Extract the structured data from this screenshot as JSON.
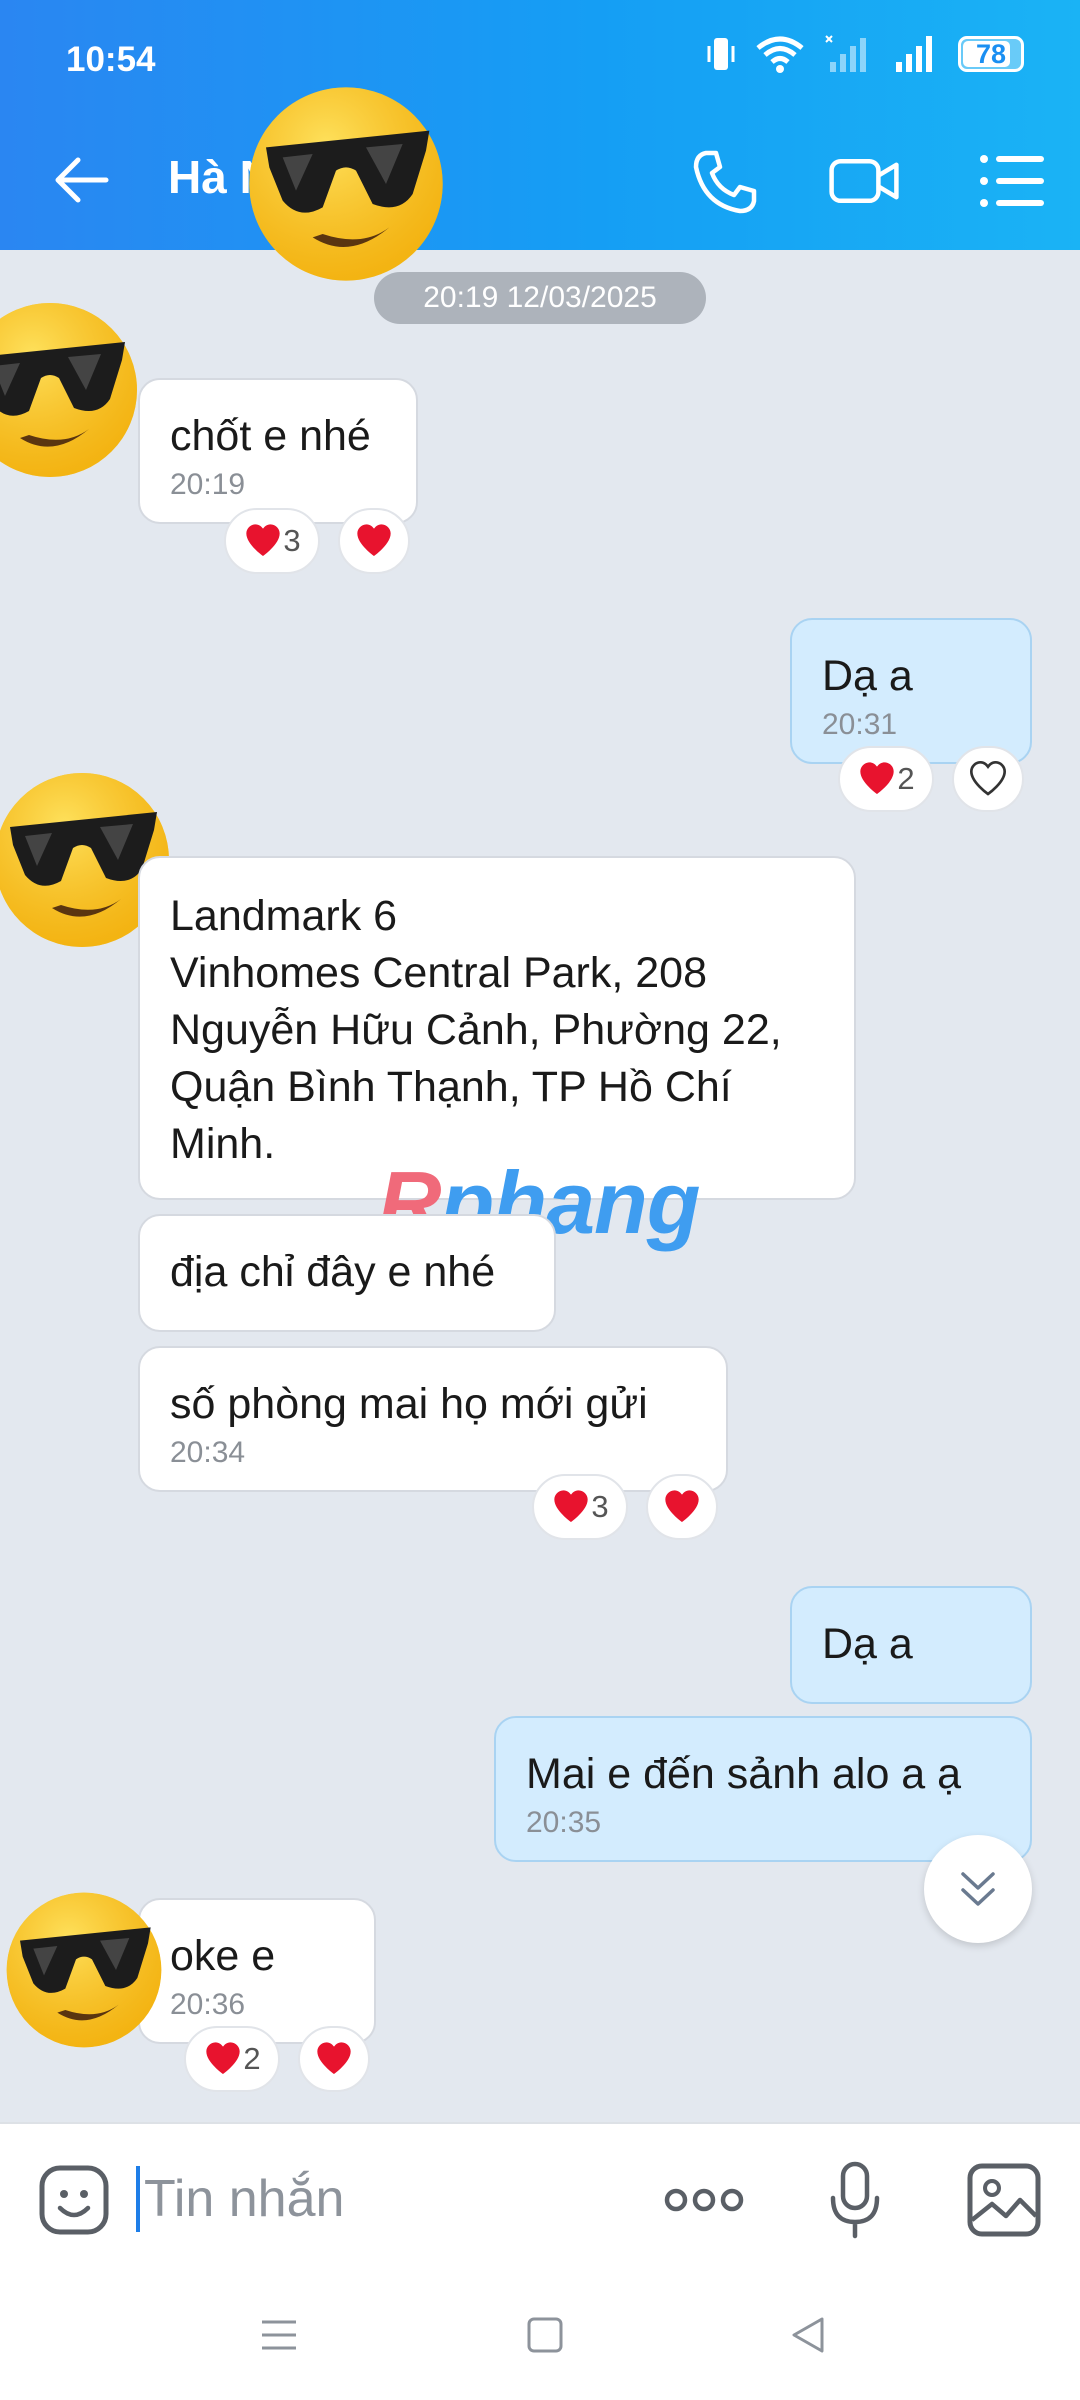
{
  "status_bar": {
    "time": "10:54",
    "battery": "78"
  },
  "header": {
    "contact_name": "Hà N"
  },
  "chat": {
    "date_divider": "20:19 12/03/2025",
    "messages": [
      {
        "side": "in",
        "text": "chốt e nhé",
        "time": "20:19",
        "reaction_count": "3"
      },
      {
        "side": "out",
        "text": "Dạ a",
        "time": "20:31",
        "reaction_count": "2"
      },
      {
        "side": "in",
        "text_lines": [
          "Landmark 6",
          "Vinhomes Central Park, 208",
          "Nguyễn Hữu Cảnh, Phường 22,",
          "Quận Bình Thạnh, TP Hồ Chí",
          "Minh."
        ]
      },
      {
        "side": "in",
        "text": "địa chỉ đây e nhé"
      },
      {
        "side": "in",
        "text": "số phòng mai họ mới gửi",
        "time": "20:34",
        "reaction_count": "3"
      },
      {
        "side": "out",
        "text": "Dạ a"
      },
      {
        "side": "out",
        "text": "Mai e đến sảnh alo a ạ",
        "time": "20:35"
      },
      {
        "side": "in",
        "text": "oke e",
        "time": "20:36",
        "reaction_count": "2"
      }
    ]
  },
  "watermark": {
    "part1": "R",
    "part2": "phang"
  },
  "input_bar": {
    "placeholder": "Tin nhắn"
  },
  "icons": [
    "sticker-icon",
    "more-icon",
    "microphone-icon",
    "image-icon",
    "phone-icon",
    "video-call-icon",
    "menu-icon",
    "back-icon",
    "heart-icon"
  ],
  "colors": {
    "header_start": "#2a86f2",
    "header_end": "#1ab3f5",
    "outgoing_bubble": "#d3ecfe",
    "incoming_bubble": "#ffffff",
    "chat_bg": "#e3e8ef",
    "heart": "#e8132e"
  }
}
